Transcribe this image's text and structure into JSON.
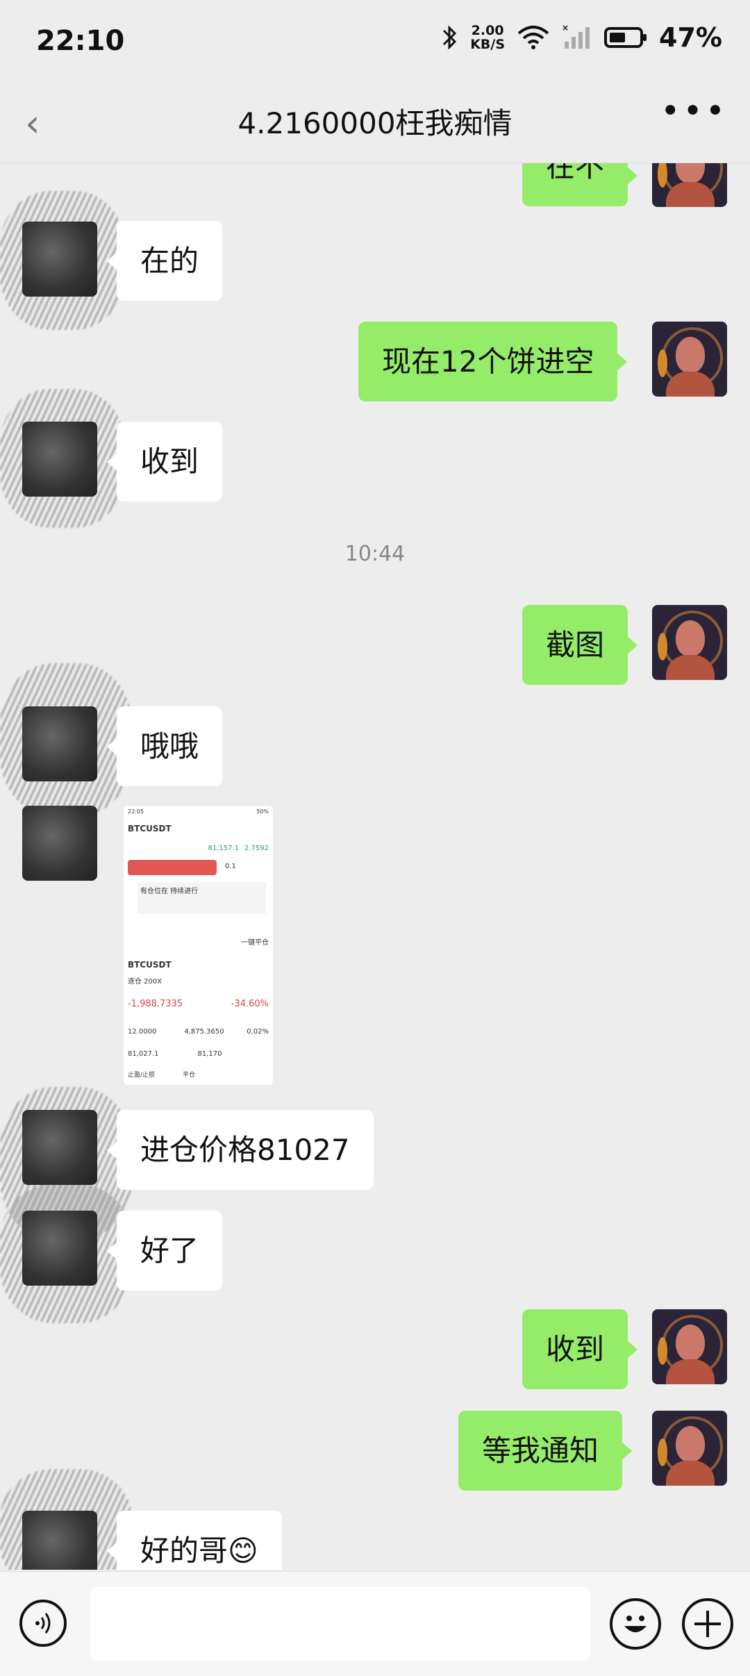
{
  "status_bar": {
    "time": "22:10",
    "net_speed_value": "2.00",
    "net_speed_unit": "KB/S",
    "battery": "47%"
  },
  "header": {
    "title": "4.2160000枉我痴情"
  },
  "messages": [
    {
      "from": "me",
      "text": "在不"
    },
    {
      "from": "other",
      "text": "在的"
    },
    {
      "from": "me",
      "text": "现在12个饼进空"
    },
    {
      "from": "other",
      "text": "收到"
    },
    {
      "from": "system",
      "text": "10:44"
    },
    {
      "from": "me",
      "text": "截图"
    },
    {
      "from": "other",
      "text": "哦哦"
    },
    {
      "from": "other",
      "type": "image"
    },
    {
      "from": "other",
      "text": "进仓价格81027"
    },
    {
      "from": "other",
      "text": "好了"
    },
    {
      "from": "me",
      "text": "收到"
    },
    {
      "from": "me",
      "text": "等我通知"
    },
    {
      "from": "other",
      "text": "好的哥😊"
    }
  ],
  "screenshot": {
    "status_time": "22:05",
    "status_battery": "50%",
    "pair": "BTCUSDT",
    "price": "81,157.1",
    "change": "2.7592",
    "qty": "0.1",
    "banner": "有仓位在 持续进行",
    "close_all": "一键平仓",
    "position_pair": "BTCUSDT",
    "position_mode": "逐仓 200X",
    "pnl": "-1,988.7335",
    "pnl_pct": "-34.60%",
    "qty_value": "12.0000",
    "margin_value": "4,875.3650",
    "rate_value": "0.02%",
    "entry_price": "81,027.1",
    "mark_price": "81,170",
    "btn_tp": "止盈/止损",
    "btn_close": "平仓"
  },
  "bottom_bar": {
    "voice_icon": "voice-icon",
    "emoji_icon": "emoji-icon",
    "add_icon": "add-icon"
  }
}
